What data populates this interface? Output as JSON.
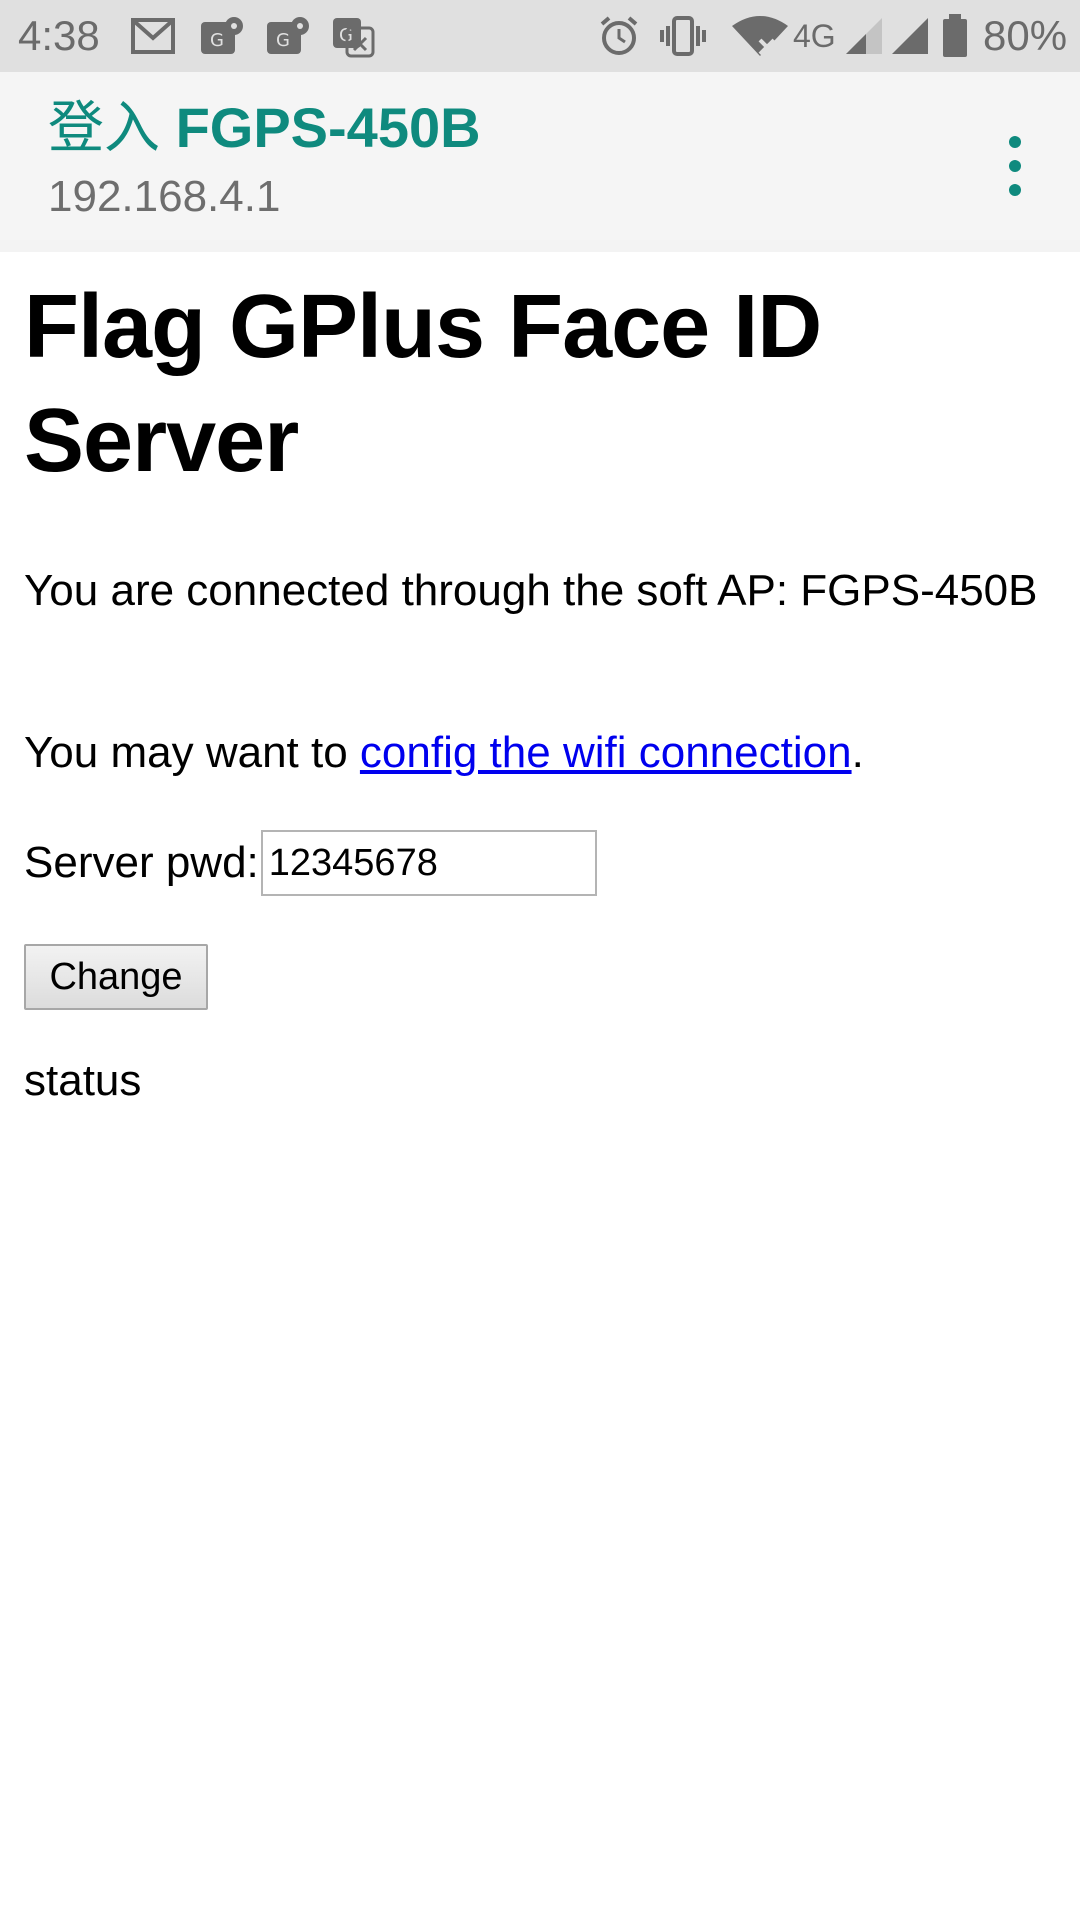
{
  "status_bar": {
    "time": "4:38",
    "network_type": "4G",
    "battery_percent": "80%",
    "icons": [
      "gmail-icon",
      "maps-icon",
      "maps-icon",
      "translate-icon",
      "alarm-icon",
      "vibrate-icon",
      "wifi-icon",
      "signal-icon",
      "signal-icon",
      "battery-icon"
    ]
  },
  "app_bar": {
    "title_prefix": "登入",
    "title_device": "FGPS-450B",
    "subtitle": "192.168.4.1",
    "accent_color": "#0f8a7e"
  },
  "page": {
    "heading": "Flag GPlus Face ID Server",
    "connection_text": "You are connected through the soft AP: FGPS-450B",
    "wifi_prefix": "You may want to ",
    "wifi_link": "config the wifi connection",
    "wifi_suffix": ".",
    "pwd_label": "Server pwd:",
    "pwd_value": "12345678",
    "change_button": "Change",
    "status": "status",
    "link_color": "#0000ee"
  }
}
